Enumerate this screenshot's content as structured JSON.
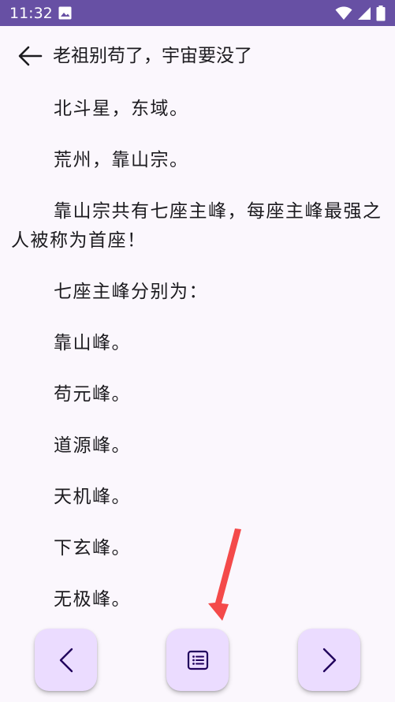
{
  "status_bar": {
    "time": "11:32",
    "icons": [
      "image-icon",
      "wifi-icon",
      "signal-icon",
      "battery-icon"
    ]
  },
  "header": {
    "back_icon": "arrow-left-icon",
    "title": "老祖别苟了，宇宙要没了"
  },
  "content": {
    "paragraphs": [
      "北斗星，东域。",
      "荒州，靠山宗。",
      "靠山宗共有七座主峰，每座主峰最强之人被称为首座！",
      "七座主峰分别为：",
      "靠山峰。",
      "苟元峰。",
      "道源峰。",
      "天机峰。",
      "下玄峰。",
      "无极峰。"
    ]
  },
  "bottom_nav": {
    "prev_icon": "chevron-left-icon",
    "toc_icon": "list-icon",
    "next_icon": "chevron-right-icon"
  },
  "colors": {
    "status_bar": "#6750a4",
    "background": "#fbf7fd",
    "button_bg": "#ebdcff",
    "button_icon": "#21005d",
    "annotation_arrow": "#f44a4a"
  }
}
